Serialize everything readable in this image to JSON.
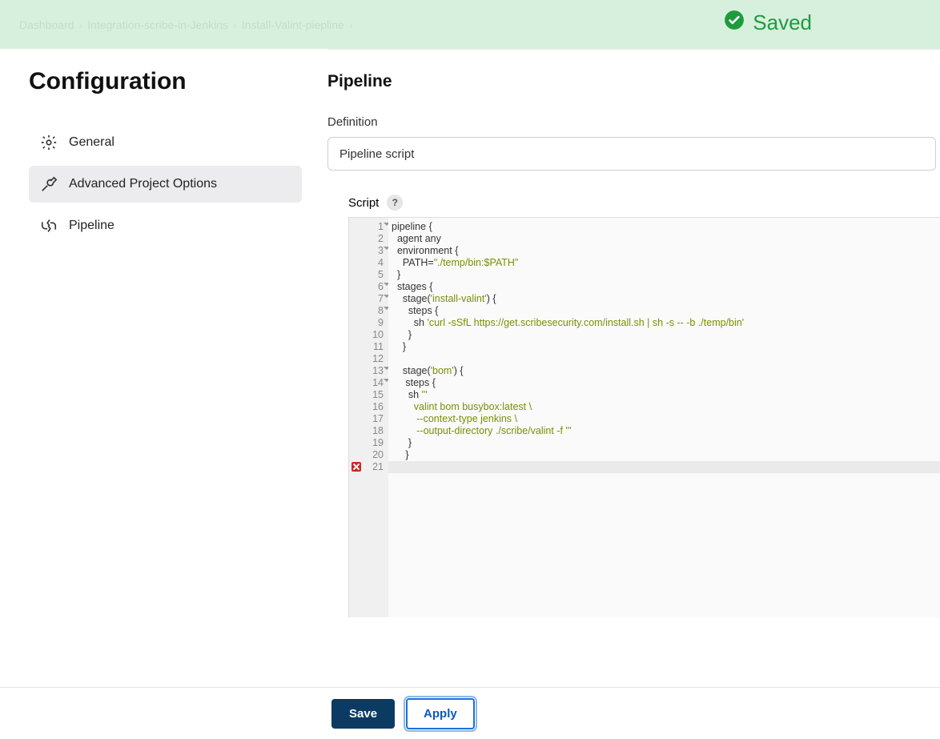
{
  "banner": {
    "saved_label": "Saved"
  },
  "breadcrumbs": [
    "Dashboard",
    "Integration-scribe-in-Jenkins",
    "Install-Valint-piepline"
  ],
  "sidebar": {
    "title": "Configuration",
    "items": [
      {
        "label": "General"
      },
      {
        "label": "Advanced Project Options"
      },
      {
        "label": "Pipeline"
      }
    ],
    "active_index": 1
  },
  "pipeline": {
    "heading": "Pipeline",
    "definition_label": "Definition",
    "definition_value": "Pipeline script",
    "script_label": "Script",
    "help_symbol": "?",
    "editor": {
      "line_count": 21,
      "fold_lines": [
        1,
        3,
        6,
        7,
        8,
        13,
        14
      ],
      "error_line": 21,
      "highlight_line": 21,
      "code_plain": [
        "pipeline {",
        "  agent any",
        "  environment {",
        "    PATH=\"./temp/bin:$PATH\"",
        "  }",
        "  stages {",
        "    stage('install-valint') {",
        "      steps {",
        "        sh 'curl -sSfL https://get.scribesecurity.com/install.sh | sh -s -- -b ./temp/bin'",
        "      }",
        "    }",
        "",
        "    stage('bom') {",
        "     steps {",
        "      sh '''",
        "        valint bom busybox:latest \\",
        "         --context-type jenkins \\",
        "         --output-directory ./scribe/valint -f '''",
        "      }",
        "     }",
        ""
      ],
      "code_html": [
        "<span class='tok-kw'>pipeline {</span>",
        "<span class='tok-kw'>  agent any</span>",
        "<span class='tok-kw'>  environment {</span>",
        "<span class='tok-kw'>    PATH=</span><span class='tok-str'>\"./temp/bin:$PATH\"</span>",
        "<span class='tok-kw'>  }</span>",
        "<span class='tok-kw'>  stages {</span>",
        "<span class='tok-kw'>    stage(</span><span class='tok-str'>'install-valint'</span><span class='tok-kw'>) {</span>",
        "<span class='tok-kw'>      steps {</span>",
        "<span class='tok-kw'>        sh </span><span class='tok-str'>'curl -sSfL https://get.scribesecurity.com/install.sh | sh -s -- -b ./temp/bin'</span>",
        "<span class='tok-kw'>      }</span>",
        "<span class='tok-kw'>    }</span>",
        "",
        "<span class='tok-kw'>    stage(</span><span class='tok-str'>'bom'</span><span class='tok-kw'>) {</span>",
        "<span class='tok-kw'>     steps {</span>",
        "<span class='tok-kw'>      sh </span><span class='tok-str'>'''</span>",
        "<span class='tok-str'>        valint bom busybox:latest \\</span>",
        "<span class='tok-str'>         --context-type jenkins \\</span>",
        "<span class='tok-str'>         --output-directory ./scribe/valint -f '''</span>",
        "<span class='tok-kw'>      }</span>",
        "<span class='tok-kw'>     }</span>",
        ""
      ]
    }
  },
  "buttons": {
    "save": "Save",
    "apply": "Apply"
  }
}
